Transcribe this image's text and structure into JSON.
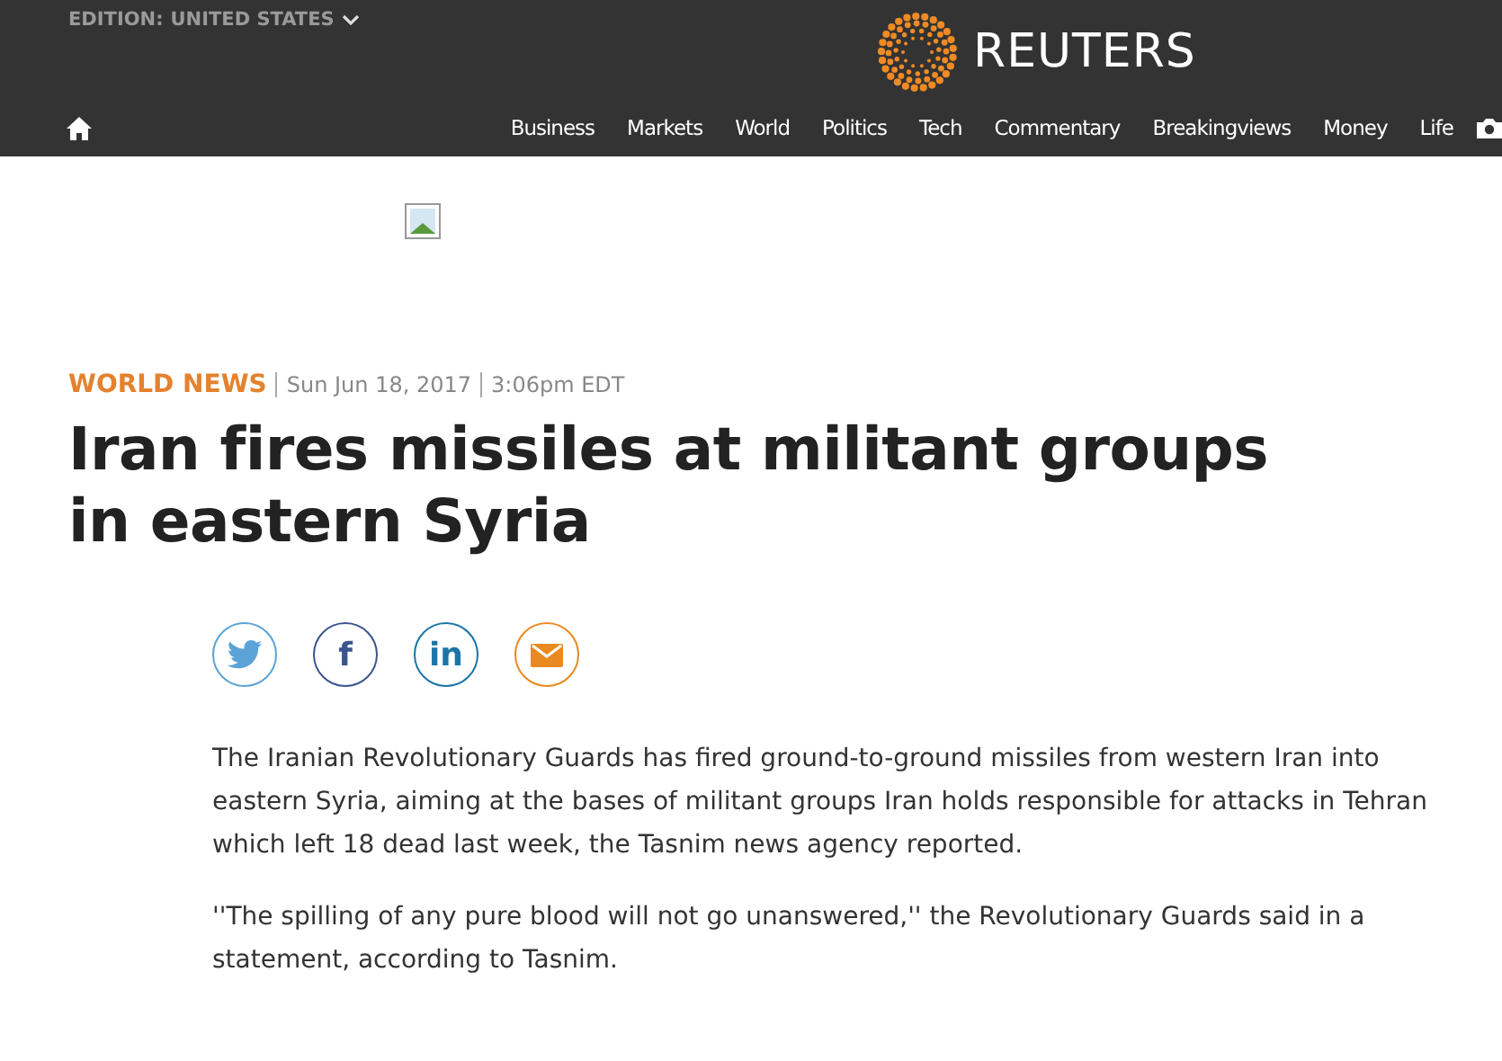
{
  "header": {
    "edition_label": "EDITION:",
    "edition_value": "UNITED STATES",
    "logo_text": "REUTERS",
    "nav": [
      "Business",
      "Markets",
      "World",
      "Politics",
      "Tech",
      "Commentary",
      "Breakingviews",
      "Money",
      "Life"
    ]
  },
  "article": {
    "category": "WORLD NEWS",
    "date": "Sun Jun 18, 2017",
    "time": "3:06pm EDT",
    "title": "Iran fires missiles at militant groups in eastern Syria",
    "share": [
      {
        "kind": "twitter"
      },
      {
        "kind": "facebook",
        "glyph": "f"
      },
      {
        "kind": "linkedin",
        "glyph": "in"
      },
      {
        "kind": "email"
      }
    ],
    "paragraphs": [
      "The Iranian Revolutionary Guards has fired ground-to-ground missiles from western Iran into eastern Syria, aiming at the bases of militant groups Iran holds responsible for attacks in Tehran which left 18 dead last week, the Tasnim news agency reported.",
      "''The spilling of any pure blood will not go unanswered,'' the Revolutionary Guards said in a statement, according to Tasnim."
    ]
  }
}
